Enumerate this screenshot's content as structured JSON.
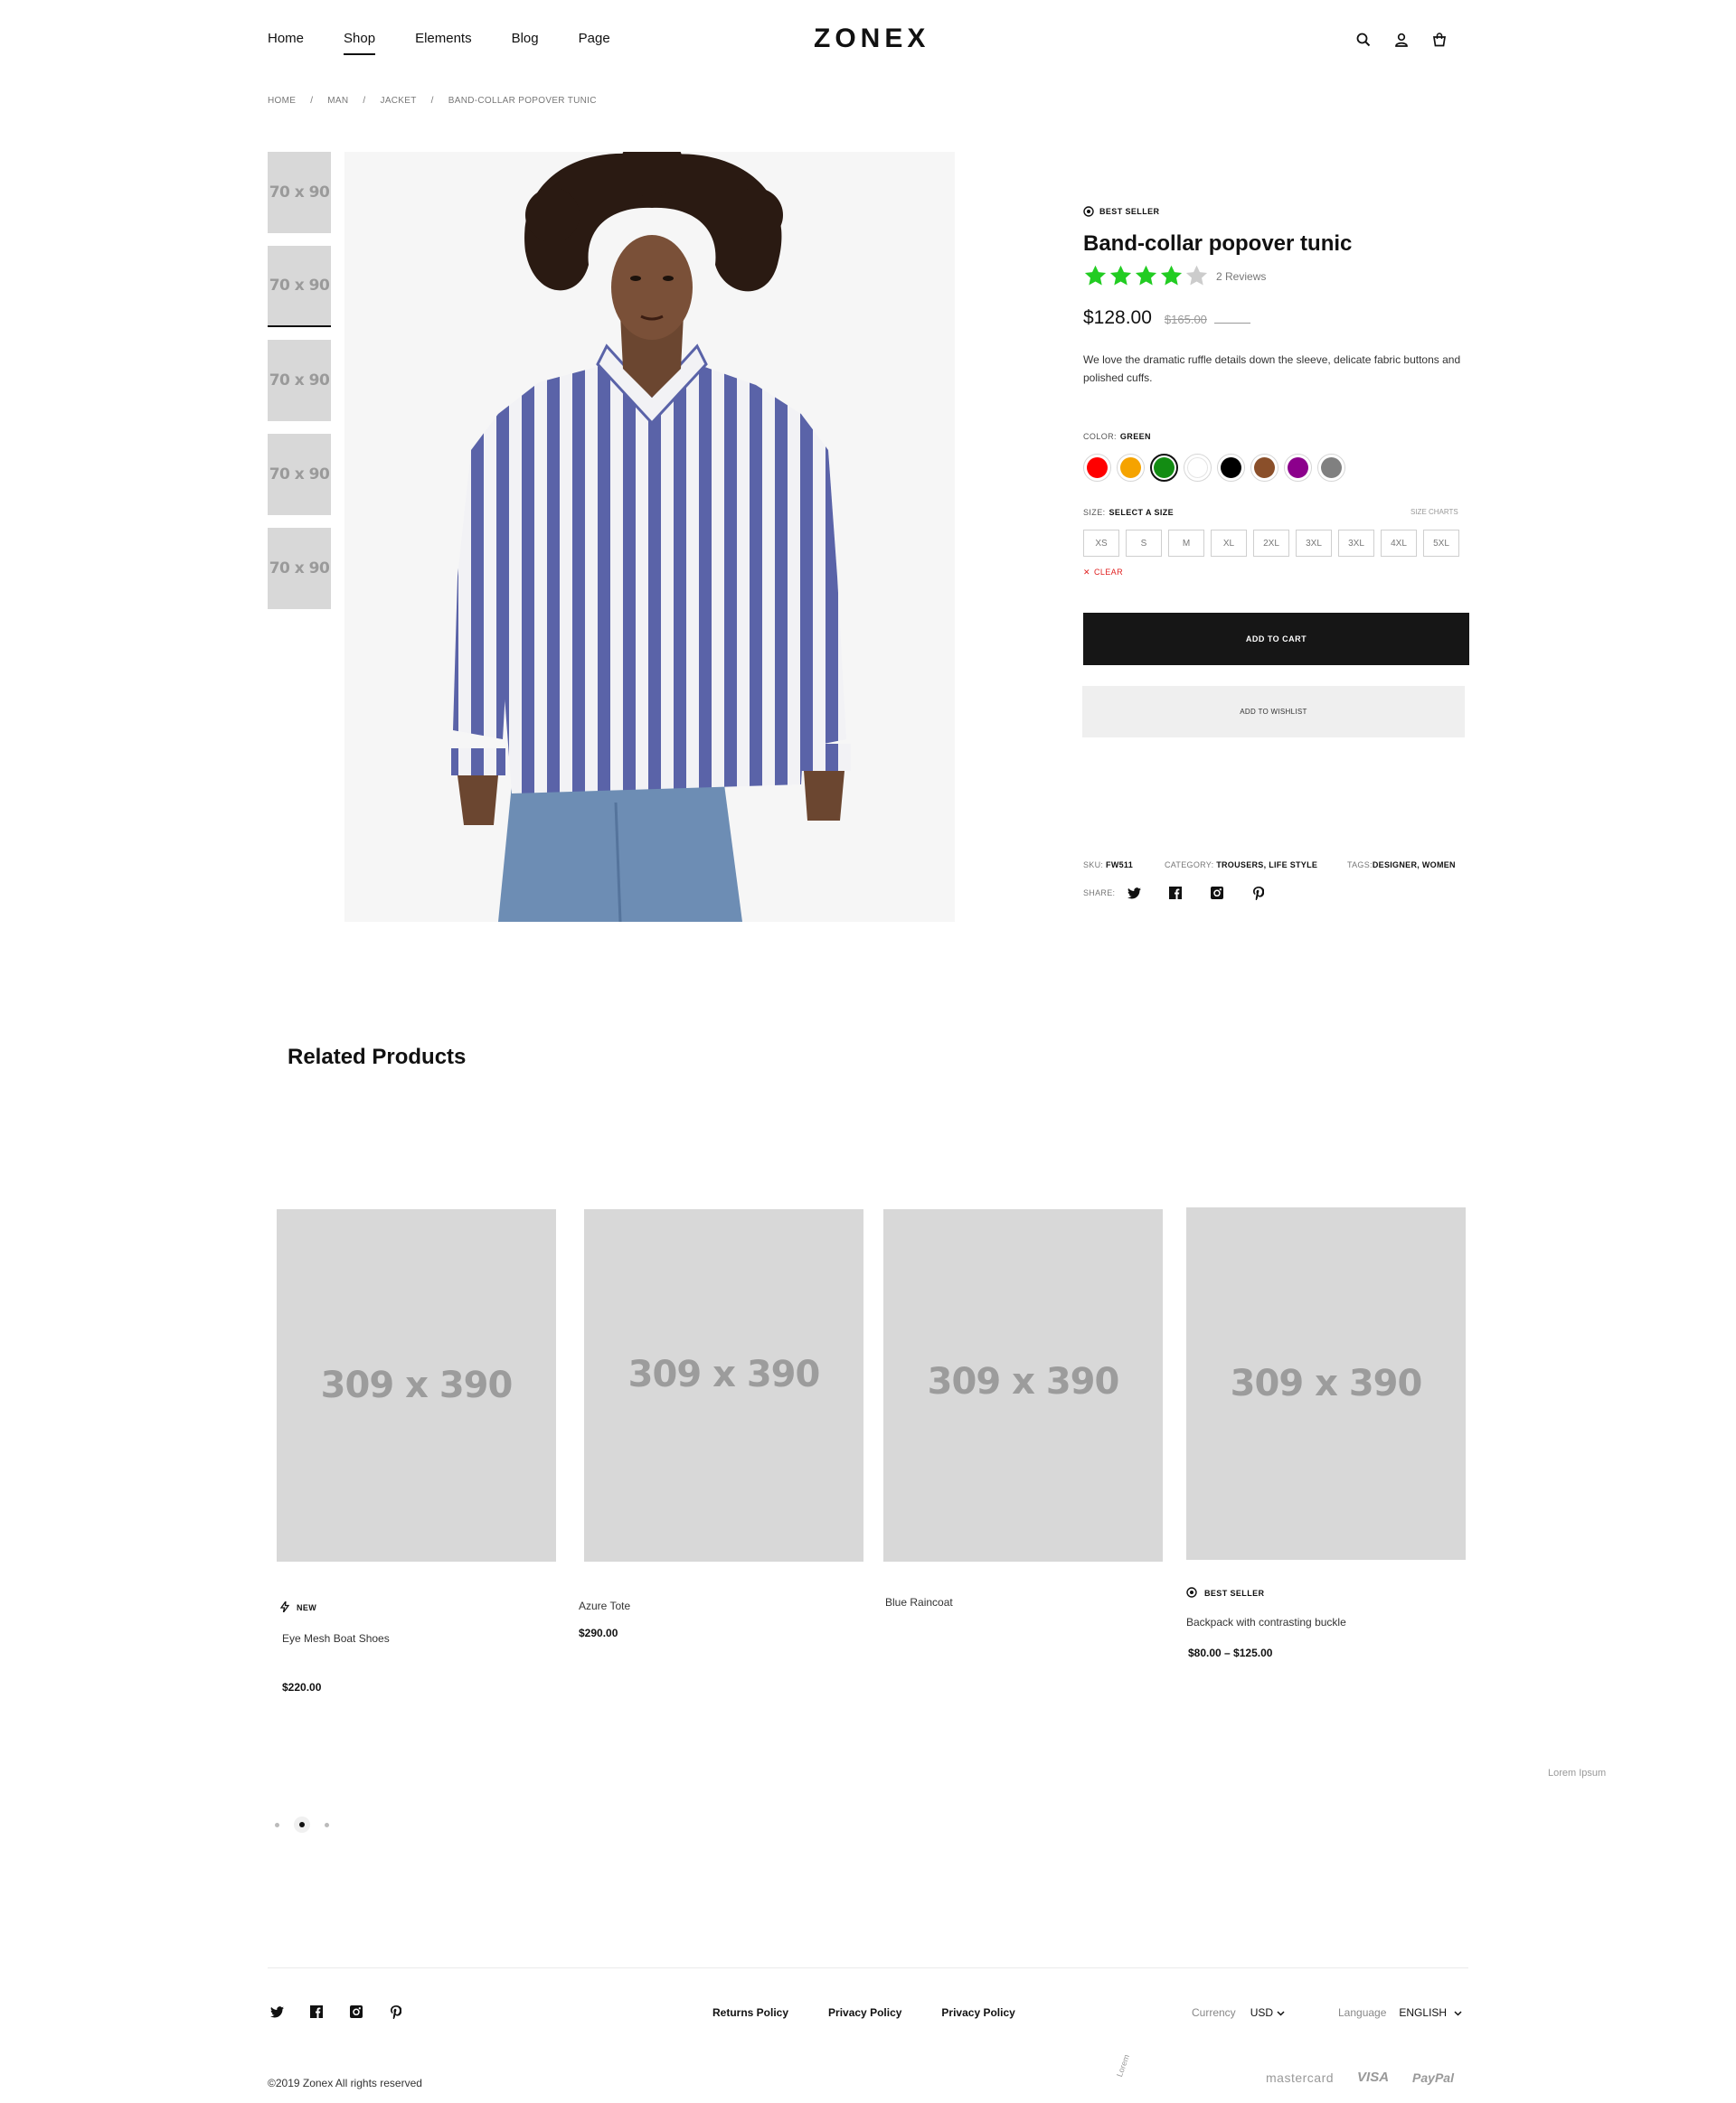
{
  "header": {
    "nav": [
      "Home",
      "Shop",
      "Elements",
      "Blog",
      "Page"
    ],
    "active_nav": "Shop",
    "logo": "ZONEX",
    "icons": [
      "search-icon",
      "user-icon",
      "cart-icon"
    ]
  },
  "breadcrumb": [
    "HOME",
    "MAN",
    "JACKET",
    "BAND-COLLAR POPOVER TUNIC"
  ],
  "gallery": {
    "thumbs": [
      "70 x 90",
      "70 x 90",
      "70 x 90",
      "70 x 90",
      "70 x 90"
    ],
    "active_thumb_index": 1,
    "main_image": "photo of a woman with curly hair wearing a blue and white striped shirt and jeans"
  },
  "product": {
    "badge": "BEST SELLER",
    "title": "Band-collar popover tunic",
    "rating": 4,
    "rating_max": 5,
    "reviews": "2 Reviews",
    "price": "$128.00",
    "old_price": "$165.00",
    "description": "We love the dramatic ruffle details down the sleeve, delicate fabric buttons and polished cuffs.",
    "color_label": "COLOR:",
    "color_value": "GREEN",
    "colors": [
      "#ff0000",
      "#f5a300",
      "#138c13",
      "#ffffff",
      "#000000",
      "#8a4f2a",
      "#8c008c",
      "#808080"
    ],
    "selected_color_index": 2,
    "size_label": "SIZE:",
    "size_value": "SELECT A SIZE",
    "size_chart": "SIZE CHARTS",
    "sizes": [
      "XS",
      "S",
      "M",
      "XL",
      "2XL",
      "3XL",
      "3XL",
      "4XL",
      "5XL"
    ],
    "clear": "CLEAR",
    "add_to_cart": "ADD TO CART",
    "add_to_wishlist": "ADD TO WISHLIST",
    "sku_label": "SKU:",
    "sku": "FW511",
    "category_label": "CATEGORY:",
    "category": "TROUSERS, LIFE STYLE",
    "tags_label": "TAGS:",
    "tags": "DESIGNER, WOMEN",
    "share_label": "SHARE:",
    "share_icons": [
      "twitter-icon",
      "facebook-icon",
      "instagram-icon",
      "pinterest-icon"
    ]
  },
  "related": {
    "title": "Related Products",
    "items": [
      {
        "image": "309 x 390",
        "badge": "NEW",
        "name": "Eye Mesh Boat Shoes",
        "price": "$220.00"
      },
      {
        "image": "309 x 390",
        "badge": "",
        "name": "Azure Tote",
        "price": "$290.00"
      },
      {
        "image": "309 x 390",
        "badge": "",
        "name": "Blue Raincoat",
        "price": ""
      },
      {
        "image": "309 x 390",
        "badge": "BEST SELLER",
        "name": "Backpack with contrasting buckle",
        "price": "$80.00 – $125.00"
      }
    ],
    "side_text": "Lorem Ipsum",
    "pagination_active": 1
  },
  "footer": {
    "social": [
      "twitter-icon",
      "facebook-icon",
      "instagram-icon",
      "pinterest-icon"
    ],
    "links": [
      "Returns Policy",
      "Privacy Policy",
      "Privacy Policy"
    ],
    "currency_label": "Currency",
    "currency_value": "USD",
    "language_label": "Language",
    "language_value": "ENGLISH",
    "copyright": "©2019 Zonex All rights reserved",
    "rotated_text": "Lorem",
    "payments": [
      "mastercard",
      "VISA",
      "PayPal"
    ]
  },
  "colors": {
    "star_filled": "#22cc22",
    "star_empty": "#cccccc",
    "cart_button": "#161616",
    "clear_red": "#e02020",
    "placeholder": "#d8d8d8"
  }
}
